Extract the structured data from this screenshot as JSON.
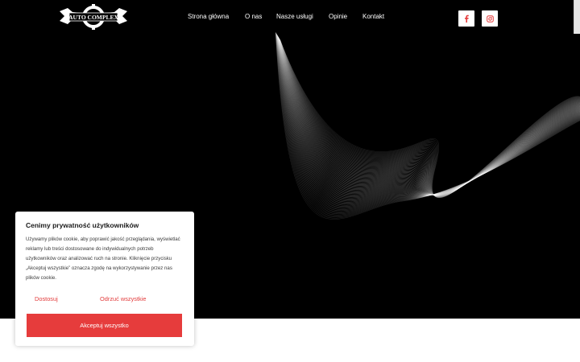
{
  "brand": {
    "logo_text": "AUTO COMPLEX"
  },
  "nav": {
    "items": [
      {
        "label": "Strona główna"
      },
      {
        "label": "O nas"
      },
      {
        "label": "Nasze usługi"
      },
      {
        "label": "Opinie"
      },
      {
        "label": "Kontakt"
      }
    ]
  },
  "social": [
    {
      "icon": "facebook-icon"
    },
    {
      "icon": "instagram-icon"
    }
  ],
  "cookie": {
    "title": "Cenimy prywatność użytkowników",
    "body": "Używamy plików cookie, aby poprawić jakość przeglądania, wyświetlać reklamy lub treści dostosowane do indywidualnych potrzeb użytkowników oraz analizować ruch na stronie. Kliknięcie przycisku „Akceptuj wszystkie” oznacza zgodę na wykorzystywanie przez nas plików cookie.",
    "customize_label": "Dostosuj",
    "reject_label": "Odrzuć wszystkie",
    "accept_label": "Akceptuj wszystko"
  },
  "colors": {
    "hero_bg": "#000000",
    "accent": "#e63c3c",
    "nav_text": "#ffffff"
  }
}
